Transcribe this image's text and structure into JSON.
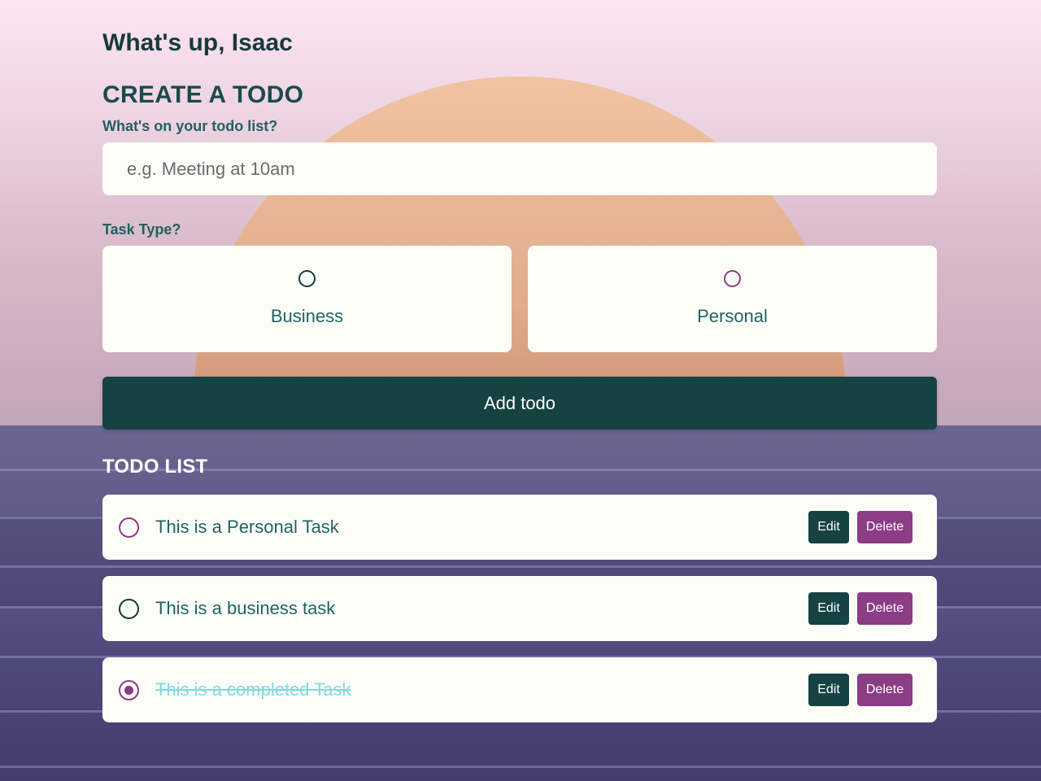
{
  "greeting": "What's up, Isaac",
  "create": {
    "heading": "CREATE A TODO",
    "question_label": "What's on your todo list?",
    "input_placeholder": "e.g. Meeting at 10am",
    "input_value": "",
    "task_type_label": "Task Type?",
    "types": [
      {
        "label": "Business",
        "selected": false,
        "color": "#163a3c"
      },
      {
        "label": "Personal",
        "selected": false,
        "color": "#8b3d86"
      }
    ],
    "add_button": "Add todo"
  },
  "list": {
    "heading": "TODO LIST",
    "items": [
      {
        "text": "This is a Personal Task",
        "type": "personal",
        "done": false
      },
      {
        "text": "This is a business task",
        "type": "business",
        "done": false
      },
      {
        "text": "This is a completed Task",
        "type": "personal",
        "done": true
      }
    ],
    "edit_label": "Edit",
    "delete_label": "Delete"
  },
  "colors": {
    "primary": "#164242",
    "personal": "#8b3d86",
    "business": "#163a3c",
    "completed_text": "#7fd9e3",
    "card": "#fdfdf8"
  }
}
